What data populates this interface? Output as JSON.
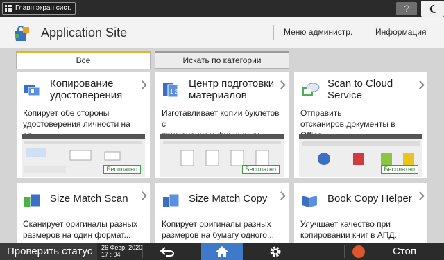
{
  "system_bar": {
    "home_label": "Главн.экран сист.",
    "help_label": "?"
  },
  "header": {
    "title": "Application Site",
    "admin_menu": "Меню администр.",
    "info": "Информация"
  },
  "tabs": [
    {
      "label": "Все",
      "active": true
    },
    {
      "label": "Искать по категории",
      "active": false
    }
  ],
  "cards": [
    {
      "title_l1": "Копирование",
      "title_l2": "удостоверения",
      "desc_l1": "Копирует обе стороны",
      "desc_l2": "удостоверения личности на од...",
      "badge": "Бесплатно",
      "icon": "id-card-copy-icon"
    },
    {
      "title_l1": "Центр подготовки",
      "title_l2": "материалов",
      "desc_l1": "Изготавливает копии буклетов с",
      "desc_l2": "применением финишных...",
      "badge": "Бесплатно",
      "icon": "booklet-center-icon"
    },
    {
      "title_l1": "Scan to Cloud",
      "title_l2": "Service",
      "desc_l1": "Отправить",
      "desc_l2": "отсканиров.документы в Office...",
      "badge": "Бесплатно",
      "icon": "cloud-scan-icon"
    },
    {
      "title_l1": "Size Match Scan",
      "title_l2": "",
      "desc_l1": "Сканирует оригиналы разных",
      "desc_l2": "размеров на один формат...",
      "icon": "size-match-scan-icon"
    },
    {
      "title_l1": "Size Match Copy",
      "title_l2": "",
      "desc_l1": "Копирует оригиналы разных",
      "desc_l2": "размеров на бумагу одного...",
      "icon": "size-match-copy-icon"
    },
    {
      "title_l1": "Book Copy Helper",
      "title_l2": "",
      "desc_l1": "Улучшает качество при",
      "desc_l2": "копировании книг в АПД.",
      "icon": "book-copy-icon"
    }
  ],
  "bottom_bar": {
    "check_status": "Проверить статус",
    "date": "26 Февр. 2020",
    "time": "17 : 04",
    "stop": "Стоп"
  },
  "colors": {
    "accent_tab": "#e3b51e",
    "home_button": "#3e7ac8",
    "stop": "#e0552a",
    "badge": "#3e9c3e"
  }
}
